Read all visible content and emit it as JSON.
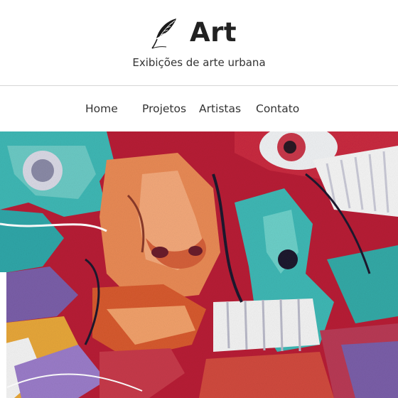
{
  "site": {
    "title": "Art",
    "tagline": "Exibições de arte urbana",
    "logo_icon": "feather-icon"
  },
  "nav": {
    "items": [
      {
        "label": "Home"
      },
      {
        "label": "Projetos"
      },
      {
        "label": "Artistas"
      },
      {
        "label": "Contato"
      }
    ]
  },
  "hero": {
    "subject": "graffiti-mural",
    "palette": [
      "#c2273a",
      "#3fb7b4",
      "#f07a3a",
      "#8c6bb8",
      "#ffffff",
      "#1e1a2e"
    ]
  }
}
